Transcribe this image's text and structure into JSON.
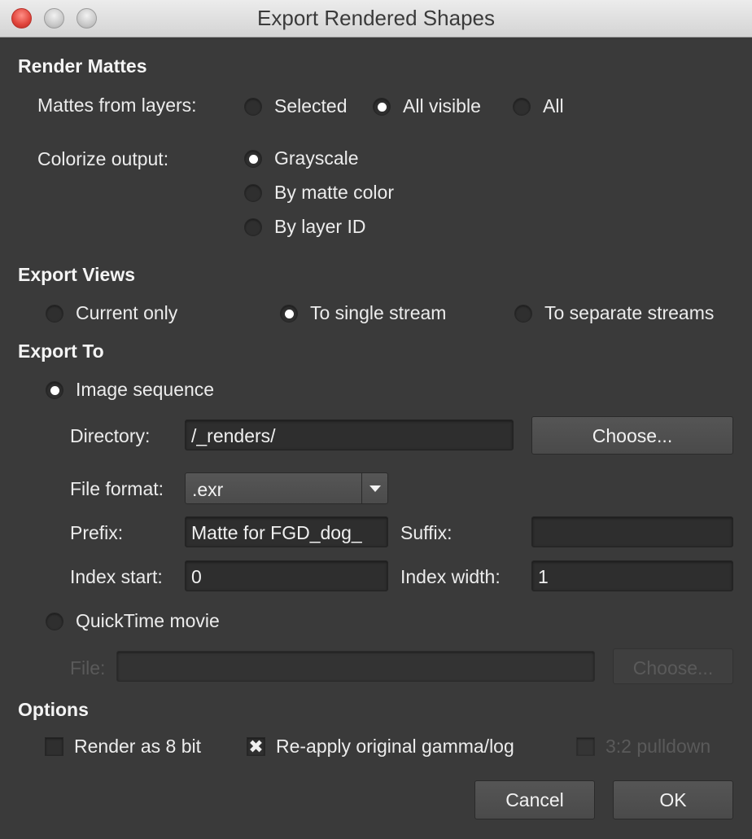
{
  "window": {
    "title": "Export Rendered Shapes"
  },
  "render_mattes": {
    "heading": "Render Mattes",
    "mattes_label": "Mattes from layers:",
    "mattes_options": [
      "Selected",
      "All visible",
      "All"
    ],
    "mattes_selected": "All visible",
    "colorize_label": "Colorize output:",
    "colorize_options": [
      "Grayscale",
      "By matte color",
      "By layer ID"
    ],
    "colorize_selected": "Grayscale"
  },
  "export_views": {
    "heading": "Export Views",
    "options": [
      "Current only",
      "To single stream",
      "To separate streams"
    ],
    "selected": "To single stream"
  },
  "export_to": {
    "heading": "Export To",
    "image_sequence_label": "Image sequence",
    "directory_label": "Directory:",
    "directory_value": "/_renders/",
    "choose_label": "Choose...",
    "file_format_label": "File format:",
    "file_format_value": ".exr",
    "prefix_label": "Prefix:",
    "prefix_value": "Matte for FGD_dog_",
    "suffix_label": "Suffix:",
    "suffix_value": "",
    "index_start_label": "Index start:",
    "index_start_value": "0",
    "index_width_label": "Index width:",
    "index_width_value": "1",
    "quicktime_label": "QuickTime movie",
    "file_label": "File:",
    "file_value": "",
    "choose_disabled_label": "Choose...",
    "selected": "Image sequence"
  },
  "options": {
    "heading": "Options",
    "render_8bit_label": "Render as 8 bit",
    "render_8bit_checked": false,
    "reapply_gamma_label": "Re-apply original gamma/log",
    "reapply_gamma_checked": true,
    "pulldown_label": "3:2 pulldown",
    "pulldown_checked": false
  },
  "footer": {
    "cancel_label": "Cancel",
    "ok_label": "OK"
  }
}
